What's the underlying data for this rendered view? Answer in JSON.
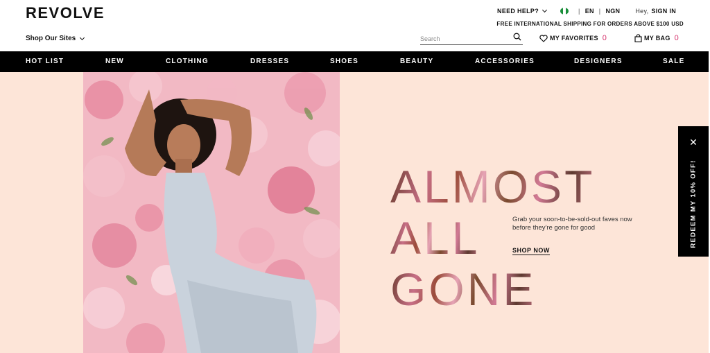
{
  "header": {
    "logo": "REVOLVE",
    "shop_sites": "Shop Our Sites",
    "need_help": "NEED HELP?",
    "lang": "EN",
    "currency": "NGN",
    "greeting": "Hey,",
    "sign_in": "SIGN IN",
    "shipping": "FREE INTERNATIONAL SHIPPING FOR ORDERS ABOVE $100 USD",
    "search_placeholder": "Search",
    "favorites_label": "MY FAVORITES",
    "favorites_count": "0",
    "bag_label": "MY BAG",
    "bag_count": "0"
  },
  "nav": {
    "items": [
      "HOT LIST",
      "NEW",
      "CLOTHING",
      "DRESSES",
      "SHOES",
      "BEAUTY",
      "ACCESSORIES",
      "DESIGNERS",
      "SALE"
    ]
  },
  "hero": {
    "headline": [
      "ALMOST",
      "ALL",
      "GONE"
    ],
    "blurb": "Grab your soon-to-be-sold-out faves now before they're gone for good",
    "cta": "SHOP NOW"
  },
  "promo_tab": {
    "label": "REDEEM MY 10% OFF!",
    "close": "✕"
  },
  "colors": {
    "accent_count": "#d4306a",
    "hero_bg": "#fde5d8",
    "nav_bg": "#000000"
  },
  "icons": [
    "chevron-down-icon",
    "nigeria-flag-icon",
    "search-icon",
    "heart-icon",
    "bag-icon",
    "close-icon"
  ]
}
